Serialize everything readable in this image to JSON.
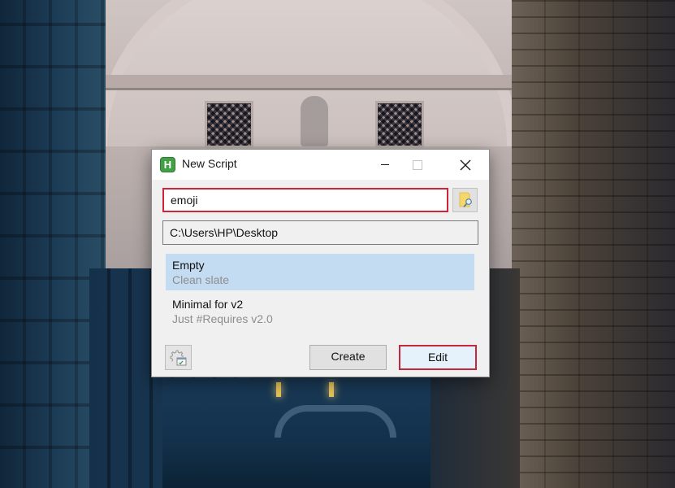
{
  "desktop": {
    "wallpaper": "Bridge of Sighs, Venice at dusk"
  },
  "dialog": {
    "title": "New Script",
    "app_icon_letter": "H",
    "app_icon_color": "#43a047",
    "controls": {
      "minimize": "minimize-icon",
      "maximize": "maximize-icon",
      "close": "close-icon"
    },
    "name_input": {
      "value": "emoji",
      "highlight_color": "#d0243a"
    },
    "browse_button_icon": "folder-search-icon",
    "path": "C:\\Users\\HP\\Desktop",
    "templates": [
      {
        "name": "Empty",
        "description": "Clean slate",
        "selected": true
      },
      {
        "name": "Minimal for v2",
        "description": "Just #Requires v2.0",
        "selected": false
      }
    ],
    "selection_color": "#c4dcf2",
    "settings_button_icon": "settings-gear-window-icon",
    "buttons": {
      "create": "Create",
      "edit": "Edit"
    },
    "edit_highlight_color": "#c4283c"
  }
}
